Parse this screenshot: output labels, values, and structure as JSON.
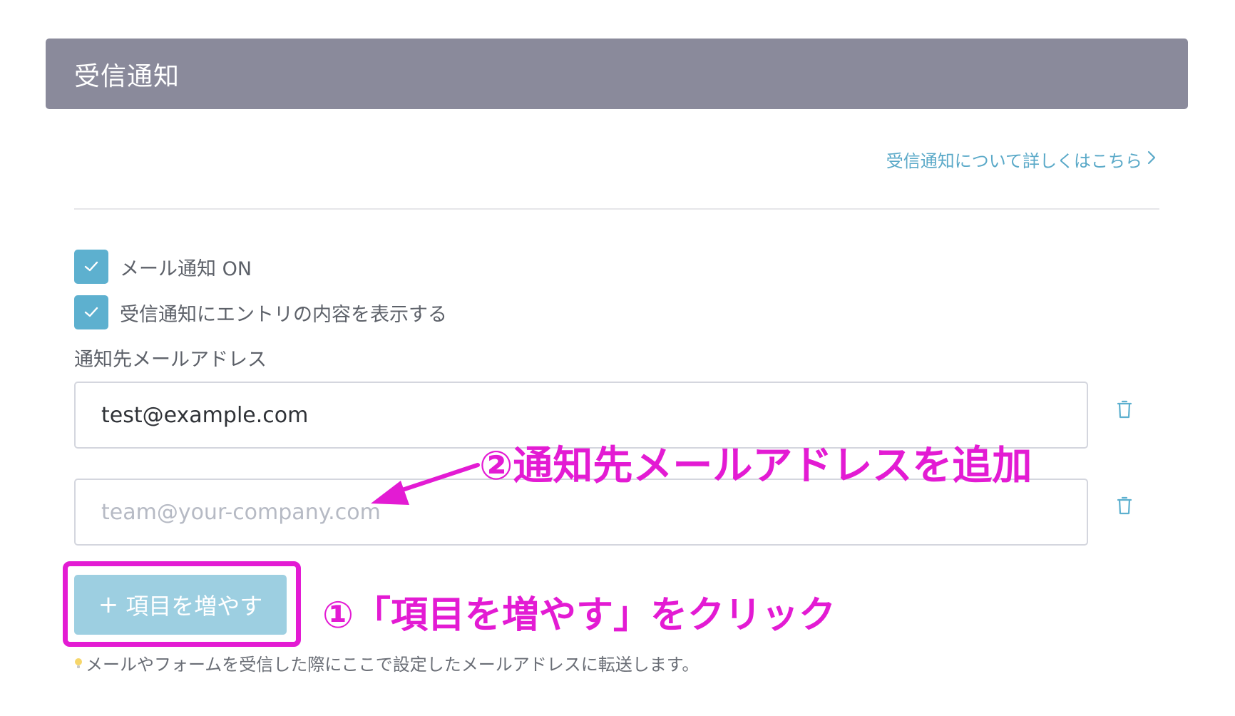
{
  "section": {
    "title": "受信通知",
    "help_link": "受信通知について詳しくはこちら",
    "help_chevron": "〉"
  },
  "options": [
    {
      "label": "メール通知 ON",
      "checked": true
    },
    {
      "label": "受信通知にエントリの内容を表示する",
      "checked": true
    }
  ],
  "emails": {
    "label": "通知先メールアドレス",
    "fields": [
      {
        "value": "test@example.com",
        "placeholder": ""
      },
      {
        "value": "",
        "placeholder": "team@your-company.com"
      }
    ]
  },
  "add_button": {
    "icon": "+",
    "label": "項目を増やす"
  },
  "hint": "メールやフォームを受信した際にここで設定したメールアドレスに転送します。",
  "annotations": {
    "step1": "①「項目を増やす」をクリック",
    "step2": "②通知先メールアドレスを追加",
    "color": "#e31bd3"
  },
  "colors": {
    "header_bg": "#8a8a9b",
    "accent": "#5db0cf",
    "button_bg": "#9dcfe1",
    "link": "#5aa9c8"
  }
}
